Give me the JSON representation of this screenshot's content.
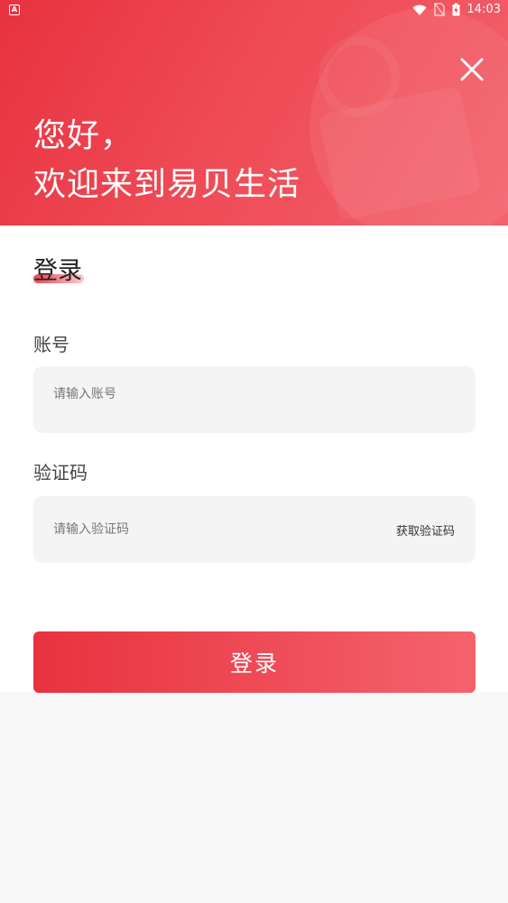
{
  "status_bar": {
    "app_icon": "A",
    "time": "14:03",
    "icons": [
      "wifi-icon",
      "no-sim-icon",
      "battery-charging-icon"
    ]
  },
  "header": {
    "greeting_line1": "您好，",
    "greeting_line2": "欢迎来到易贝生活",
    "close_icon": "close-icon"
  },
  "form": {
    "title": "登录",
    "account_label": "账号",
    "account_placeholder": "请输入账号",
    "code_label": "验证码",
    "code_placeholder": "请输入验证码",
    "get_code_label": "获取验证码",
    "submit_label": "登录"
  },
  "colors": {
    "brand_red": "#e8323f",
    "brand_pink": "#f4636d",
    "field_bg": "#f4f4f4",
    "page_bg": "#f8f8f8"
  }
}
